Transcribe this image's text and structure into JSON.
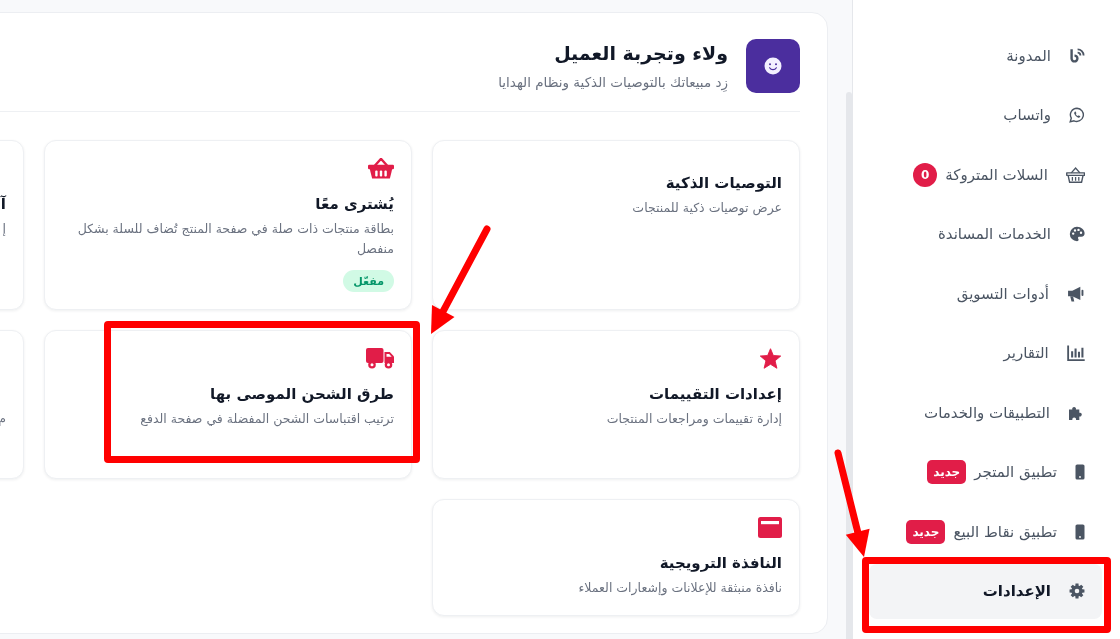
{
  "section": {
    "title": "ولاء وتجربة العميل",
    "subtitle": "زِد مبيعاتك بالتوصيات الذكية ونظام الهدايا",
    "cards": [
      {
        "title": "التوصيات الذكية",
        "description": "عرض توصيات ذكية للمنتجات",
        "highlighted": false
      },
      {
        "title": "يُشترى معًا",
        "description": "بطاقة منتجات ذات صلة في صفحة المنتج تُضاف للسلة بشكل منفصل",
        "badge": "مفعّل",
        "highlighted": false
      },
      {
        "title": "آ",
        "description": "إ",
        "highlighted": false
      },
      {
        "title": "إعدادات التقييمات",
        "description": "إدارة تقييمات ومراجعات المنتجات",
        "highlighted": false
      },
      {
        "title": "طرق الشحن الموصى بها",
        "description": "ترتيب اقتباسات الشحن المفضلة في صفحة الدفع",
        "highlighted": true
      },
      {
        "description": "م",
        "highlighted": false
      },
      {
        "title": "النافذة الترويجية",
        "description": "نافذة منبثقة للإعلانات وإشعارات العملاء",
        "highlighted": false
      }
    ]
  },
  "sidebar": {
    "items": [
      {
        "label": "المدونة",
        "selected": false,
        "highlighted": false
      },
      {
        "label": "واتساب",
        "selected": false,
        "highlighted": false
      },
      {
        "label": "السلات المتروكة",
        "badge": {
          "text": "0",
          "kind": "count"
        },
        "selected": false,
        "highlighted": false
      },
      {
        "label": "الخدمات المساندة",
        "selected": false,
        "highlighted": false
      },
      {
        "label": "أدوات التسويق",
        "selected": false,
        "highlighted": false
      },
      {
        "label": "التقارير",
        "selected": false,
        "highlighted": false
      },
      {
        "label": "التطبيقات والخدمات",
        "selected": false,
        "highlighted": false
      },
      {
        "label": "تطبيق المتجر",
        "badge": {
          "text": "جديد",
          "kind": "new"
        },
        "selected": false,
        "highlighted": false
      },
      {
        "label": "تطبيق نقاط البيع",
        "badge": {
          "text": "جديد",
          "kind": "new"
        },
        "selected": false,
        "highlighted": false
      },
      {
        "label": "الإعدادات",
        "selected": true,
        "highlighted": true
      }
    ]
  }
}
